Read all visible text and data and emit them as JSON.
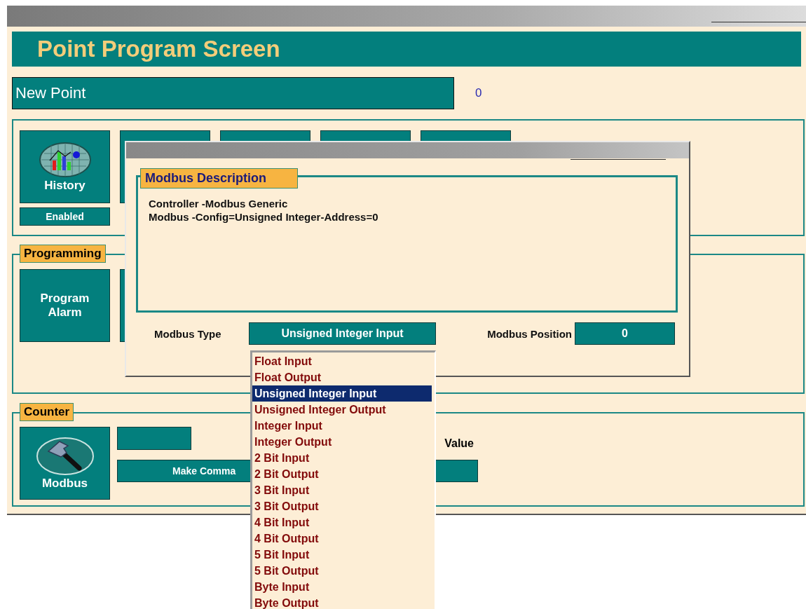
{
  "header": {
    "title": "Point Program Screen"
  },
  "point": {
    "name": "New Point",
    "number": "0"
  },
  "status_section": {
    "history": {
      "label": "History",
      "status": "Enabled"
    }
  },
  "programming": {
    "title": "Programming",
    "buttons": [
      {
        "label": "Program Alarm"
      }
    ]
  },
  "counter": {
    "title": "Counter",
    "button": {
      "label": "Modbus"
    },
    "command_button": "Make Comma",
    "value_label": "Value"
  },
  "dialog": {
    "group_title": "Modbus Description",
    "description_lines": [
      "Controller -Modbus Generic",
      "Modbus -Config=Unsigned Integer-Address=0"
    ],
    "type_label": "Modbus Type",
    "type_value": "Unsigned Integer Input",
    "position_label": "Modbus Position",
    "position_value": "0"
  },
  "dropdown": {
    "options": [
      {
        "label": "Float Input",
        "selected": false
      },
      {
        "label": "Float Output",
        "selected": false
      },
      {
        "label": "Unsigned Integer Input",
        "selected": true
      },
      {
        "label": "Unsigned Integer Output",
        "selected": false
      },
      {
        "label": "Integer Input",
        "selected": false
      },
      {
        "label": "Integer Output",
        "selected": false
      },
      {
        "label": "2 Bit Input",
        "selected": false
      },
      {
        "label": "2 Bit Output",
        "selected": false
      },
      {
        "label": "3 Bit Input",
        "selected": false
      },
      {
        "label": "3 Bit Output",
        "selected": false
      },
      {
        "label": "4 Bit Input",
        "selected": false
      },
      {
        "label": "4 Bit Output",
        "selected": false
      },
      {
        "label": "5 Bit Input",
        "selected": false
      },
      {
        "label": "5 Bit Output",
        "selected": false
      },
      {
        "label": "Byte Input",
        "selected": false
      },
      {
        "label": "Byte Output",
        "selected": false
      }
    ]
  }
}
